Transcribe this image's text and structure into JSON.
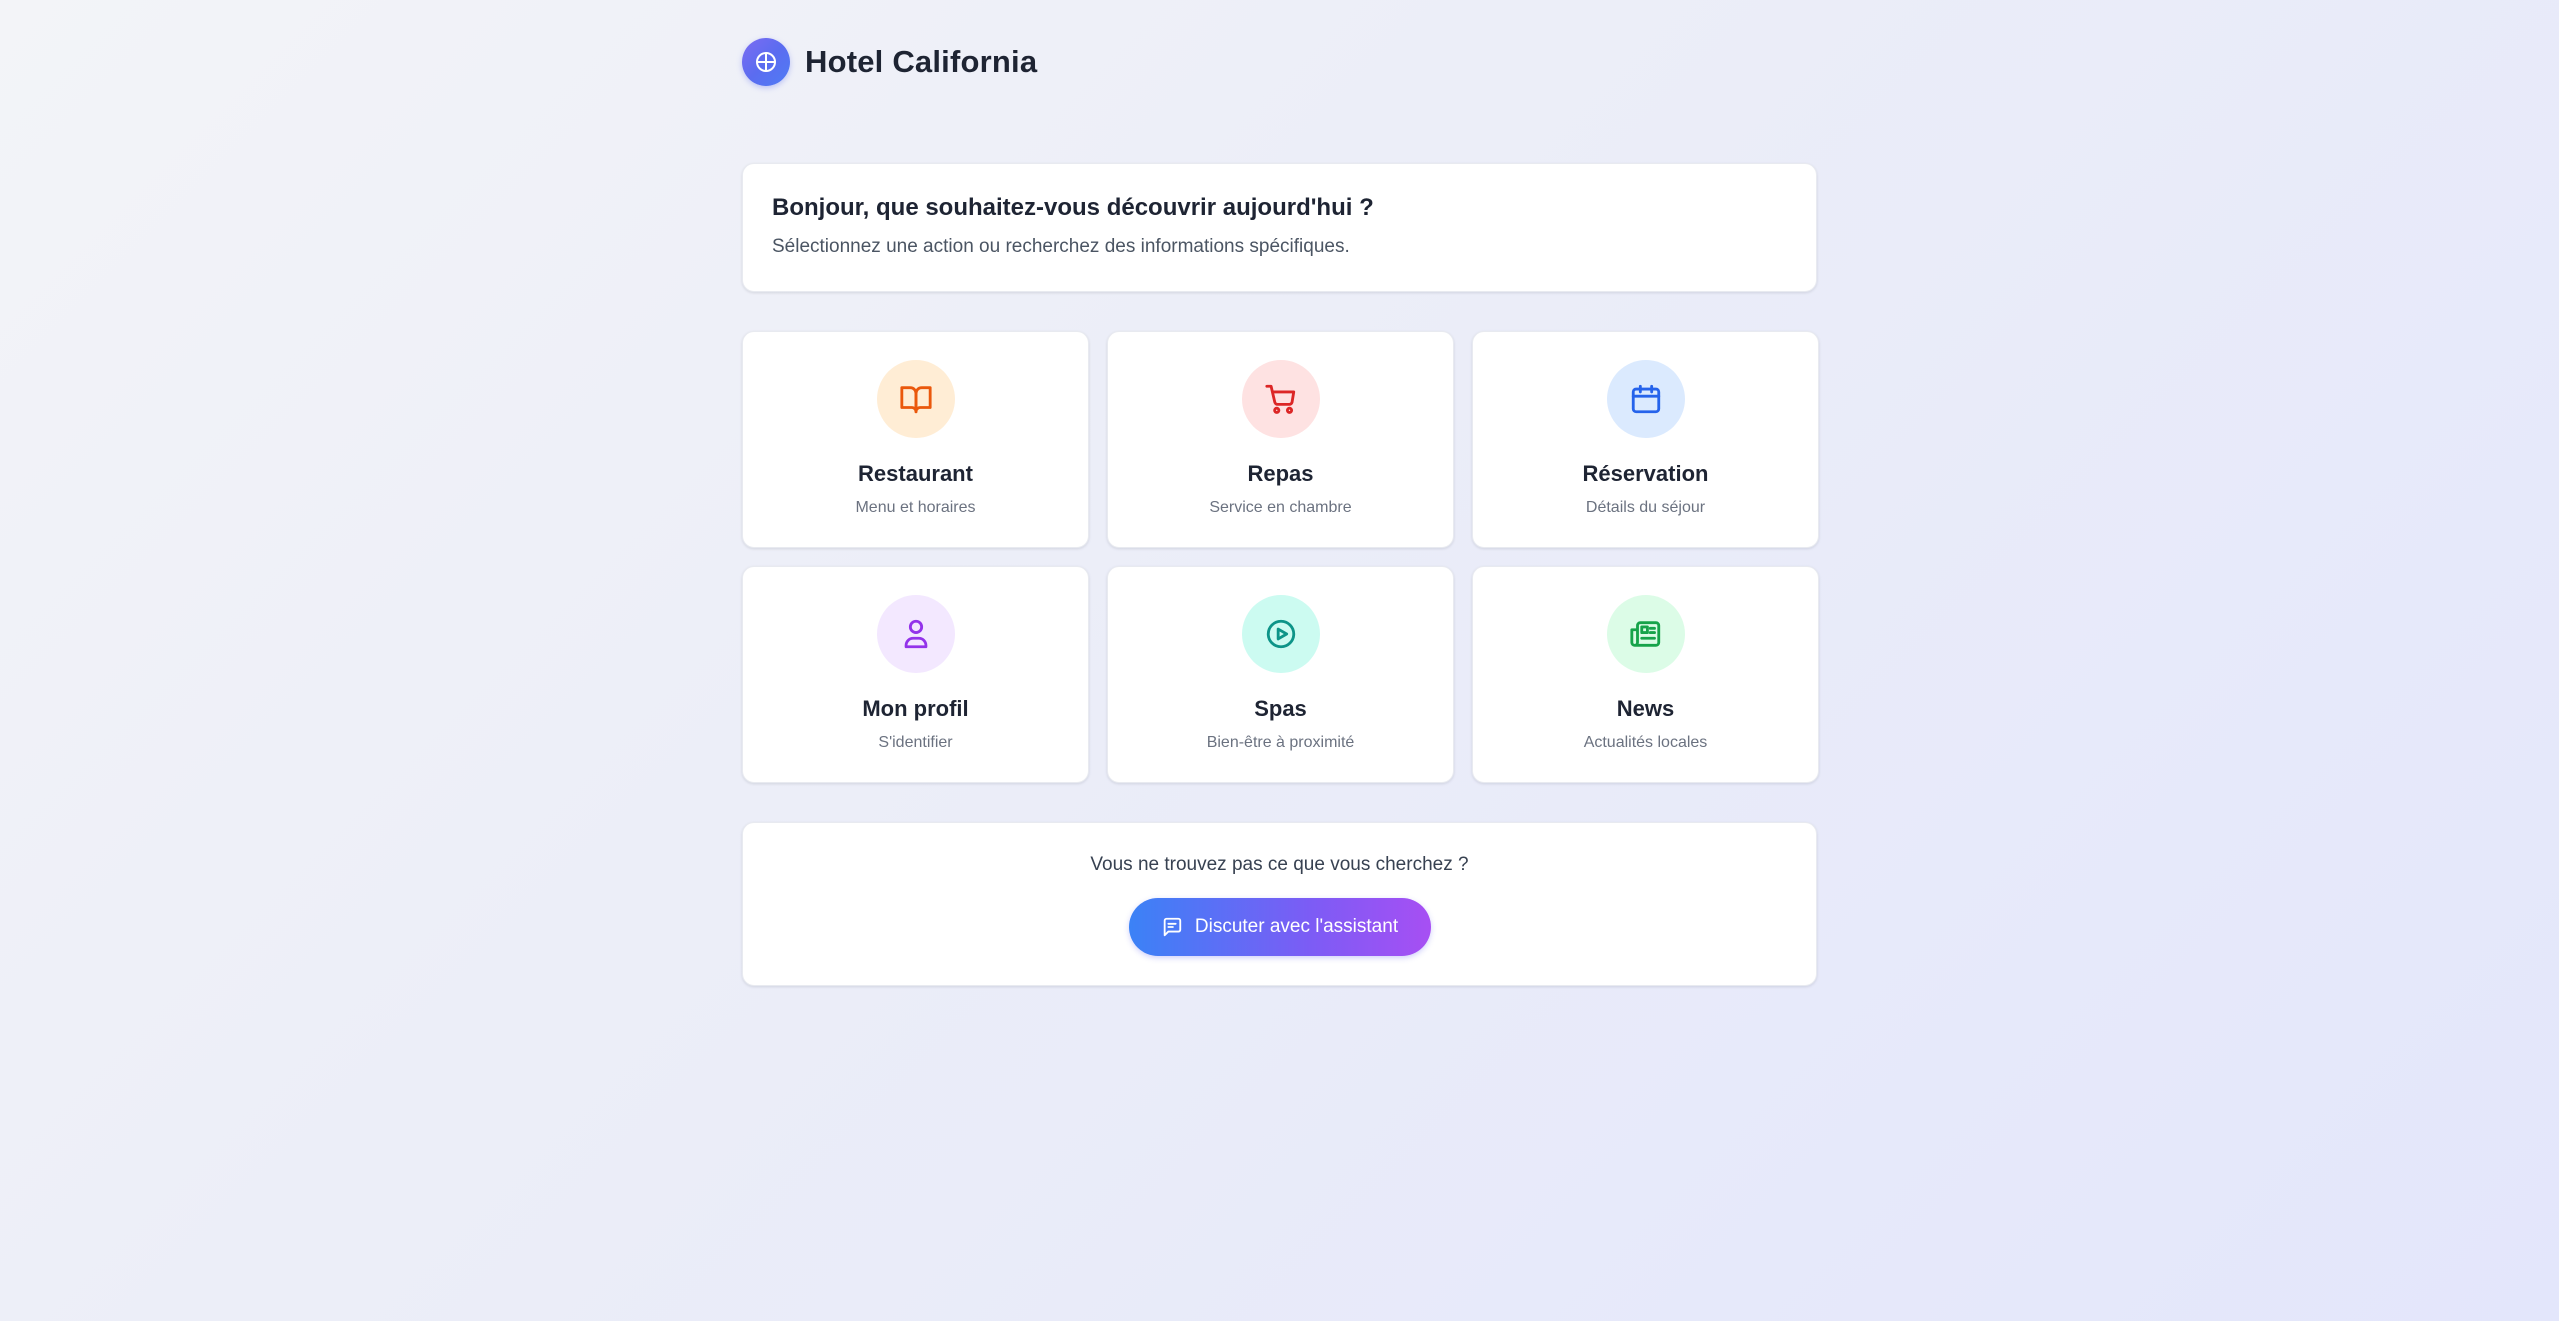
{
  "header": {
    "title": "Hotel California",
    "logo_icon": "globe-icon"
  },
  "intro": {
    "title": "Bonjour, que souhaitez-vous découvrir aujourd'hui ?",
    "subtitle": "Sélectionnez une action ou recherchez des informations spécifiques."
  },
  "tiles": [
    {
      "title": "Restaurant",
      "subtitle": "Menu et horaires",
      "icon": "book-open-icon",
      "icon_color": "#ea580c",
      "icon_bg": "#ffedd5"
    },
    {
      "title": "Repas",
      "subtitle": "Service en chambre",
      "icon": "shopping-cart-icon",
      "icon_color": "#dc2626",
      "icon_bg": "#fee2e2"
    },
    {
      "title": "Réservation",
      "subtitle": "Détails du séjour",
      "icon": "calendar-icon",
      "icon_color": "#2563eb",
      "icon_bg": "#dbeafe"
    },
    {
      "title": "Mon profil",
      "subtitle": "S'identifier",
      "icon": "user-icon",
      "icon_color": "#9333ea",
      "icon_bg": "#f3e8ff"
    },
    {
      "title": "Spas",
      "subtitle": "Bien-être à proximité",
      "icon": "play-circle-icon",
      "icon_color": "#0d9488",
      "icon_bg": "#ccfbf1"
    },
    {
      "title": "News",
      "subtitle": "Actualités locales",
      "icon": "newspaper-icon",
      "icon_color": "#16a34a",
      "icon_bg": "#dcfce7"
    }
  ],
  "help": {
    "text": "Vous ne trouvez pas ce que vous cherchez ?",
    "button_label": "Discuter avec l'assistant",
    "button_icon": "message-square-icon"
  }
}
